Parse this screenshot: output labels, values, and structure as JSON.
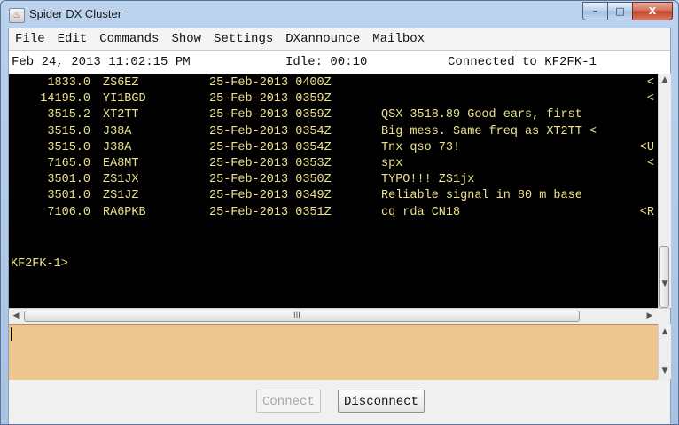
{
  "window": {
    "title": "Spider DX Cluster",
    "minimize": "–",
    "maximize": "□",
    "close": "X"
  },
  "menu": [
    "File",
    "Edit",
    "Commands",
    "Show",
    "Settings",
    "DXannounce",
    "Mailbox"
  ],
  "status": {
    "datetime": "Feb 24, 2013 11:02:15 PM",
    "idle": "Idle: 00:10",
    "connection": "Connected to KF2FK-1"
  },
  "spots": [
    {
      "freq": "1833.0",
      "call": "ZS6EZ",
      "time": "25-Feb-2013 0400Z",
      "comment": "",
      "tail": "<"
    },
    {
      "freq": "14195.0",
      "call": "YI1BGD",
      "time": "25-Feb-2013 0359Z",
      "comment": "",
      "tail": "<"
    },
    {
      "freq": "3515.2",
      "call": "XT2TT",
      "time": "25-Feb-2013 0359Z",
      "comment": "QSX 3518.89 Good ears, first",
      "tail": ""
    },
    {
      "freq": "3515.0",
      "call": "J38A",
      "time": "25-Feb-2013 0354Z",
      "comment": "Big mess. Same freq as XT2TT <",
      "tail": ""
    },
    {
      "freq": "3515.0",
      "call": "J38A",
      "time": "25-Feb-2013 0354Z",
      "comment": "Tnx qso 73!",
      "tail": "<U"
    },
    {
      "freq": "7165.0",
      "call": "EA8MT",
      "time": "25-Feb-2013 0353Z",
      "comment": "spx",
      "tail": "<"
    },
    {
      "freq": "3501.0",
      "call": "ZS1JX",
      "time": "25-Feb-2013 0350Z",
      "comment": "TYPO!!! ZS1jx",
      "tail": ""
    },
    {
      "freq": "3501.0",
      "call": "ZS1JZ",
      "time": "25-Feb-2013 0349Z",
      "comment": "Reliable signal in 80 m base",
      "tail": ""
    },
    {
      "freq": "7106.0",
      "call": "RA6PKB",
      "time": "25-Feb-2013 0351Z",
      "comment": "cq rda CN18",
      "tail": "<R"
    }
  ],
  "prompt": "KF2FK-1>",
  "hscroll_grip": "III",
  "buttons": {
    "connect": "Connect",
    "disconnect": "Disconnect"
  },
  "colors": {
    "terminal_bg": "#000000",
    "terminal_text": "#ece28a",
    "input_bg": "#ecc68e"
  }
}
